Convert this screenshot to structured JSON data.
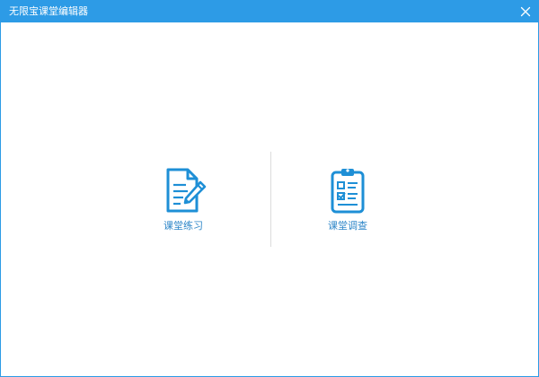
{
  "window": {
    "title": "无限宝课堂编辑器"
  },
  "tiles": [
    {
      "label": "课堂练习",
      "icon": "edit-document-icon"
    },
    {
      "label": "课堂调查",
      "icon": "clipboard-checklist-icon"
    }
  ],
  "colors": {
    "accent": "#2d9be6",
    "icon": "#1e8fd6",
    "label": "#2d86c8",
    "divider": "#dcdcdc"
  }
}
